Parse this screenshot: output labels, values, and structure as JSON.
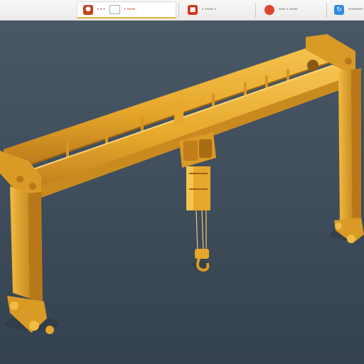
{
  "toolbar": {
    "tabs": [
      {
        "title": "• • • ",
        "icon": "app-badge-icon",
        "icon_color": "#c4421c"
      },
      {
        "title": "• ••••• •",
        "icon": "pdf-icon",
        "icon_color": "#d9331f"
      },
      {
        "title": "•••• • •••••",
        "icon": "red-dot-icon",
        "icon_color": "#e0462f"
      },
      {
        "title": "••••••••• •",
        "icon": "refresh-icon",
        "icon_color": "#2f8de0"
      }
    ]
  },
  "scene": {
    "subject": "gantry-crane",
    "colors": {
      "background": "#3f4d5c",
      "crane": "#e6a72b",
      "crane_shadow": "#b8781a",
      "crane_highlight": "#f6c451"
    }
  }
}
